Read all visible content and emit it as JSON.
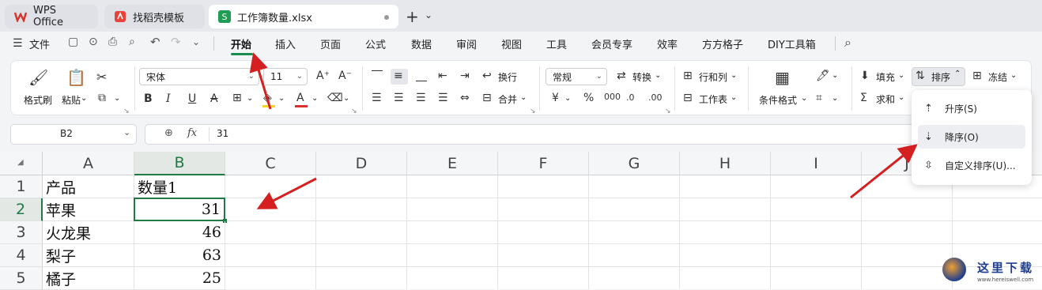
{
  "tabs": [
    {
      "label": "WPS Office"
    },
    {
      "label": "找稻壳模板"
    },
    {
      "label": "工作簿数量.xlsx"
    }
  ],
  "menubar": {
    "file_label": "文件",
    "items": [
      "开始",
      "插入",
      "页面",
      "公式",
      "数据",
      "审阅",
      "视图",
      "工具",
      "会员专享",
      "效率",
      "方方格子",
      "DIY工具箱"
    ],
    "active": "开始"
  },
  "ribbon": {
    "format_painter": "格式刷",
    "paste": "粘贴",
    "font_name": "宋体",
    "font_size": "11",
    "wrap": "换行",
    "merge": "合并",
    "number_format": "常规",
    "convert": "转换",
    "rows_cols": "行和列",
    "worksheet": "工作表",
    "conditional_format": "条件格式",
    "fill": "填充",
    "sum": "求和",
    "sort": "排序",
    "freeze": "冻结",
    "font_color_hex": "#d9302b",
    "highlight_hex": "#f5d327"
  },
  "formula": {
    "cell_ref": "B2",
    "fx": "fx",
    "value": "31"
  },
  "sheet": {
    "columns": [
      "A",
      "B",
      "C",
      "D",
      "E",
      "F",
      "G",
      "H",
      "I",
      "J"
    ],
    "rows": [
      "1",
      "2",
      "3",
      "4",
      "5"
    ],
    "cells": [
      [
        "产品",
        "数量1"
      ],
      [
        "苹果",
        "31"
      ],
      [
        "火龙果",
        "46"
      ],
      [
        "梨子",
        "63"
      ],
      [
        "橘子",
        "25"
      ]
    ]
  },
  "sort_menu": {
    "items": [
      "升序(S)",
      "降序(O)",
      "自定义排序(U)..."
    ]
  },
  "accent_color": "#1f7a45",
  "arrow_color": "#d42020",
  "watermark": {
    "text": "这里下载",
    "url_text": "www.hereiswell.com"
  }
}
